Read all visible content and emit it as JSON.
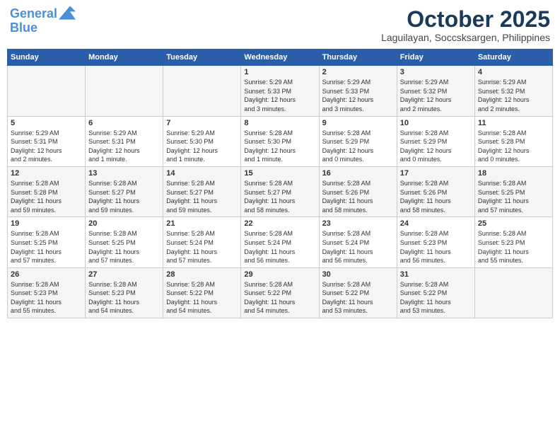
{
  "header": {
    "logo_line1": "General",
    "logo_line2": "Blue",
    "month": "October 2025",
    "location": "Laguilayan, Soccsksargen, Philippines"
  },
  "weekdays": [
    "Sunday",
    "Monday",
    "Tuesday",
    "Wednesday",
    "Thursday",
    "Friday",
    "Saturday"
  ],
  "weeks": [
    [
      {
        "day": "",
        "info": ""
      },
      {
        "day": "",
        "info": ""
      },
      {
        "day": "",
        "info": ""
      },
      {
        "day": "1",
        "info": "Sunrise: 5:29 AM\nSunset: 5:33 PM\nDaylight: 12 hours\nand 3 minutes."
      },
      {
        "day": "2",
        "info": "Sunrise: 5:29 AM\nSunset: 5:33 PM\nDaylight: 12 hours\nand 3 minutes."
      },
      {
        "day": "3",
        "info": "Sunrise: 5:29 AM\nSunset: 5:32 PM\nDaylight: 12 hours\nand 2 minutes."
      },
      {
        "day": "4",
        "info": "Sunrise: 5:29 AM\nSunset: 5:32 PM\nDaylight: 12 hours\nand 2 minutes."
      }
    ],
    [
      {
        "day": "5",
        "info": "Sunrise: 5:29 AM\nSunset: 5:31 PM\nDaylight: 12 hours\nand 2 minutes."
      },
      {
        "day": "6",
        "info": "Sunrise: 5:29 AM\nSunset: 5:31 PM\nDaylight: 12 hours\nand 1 minute."
      },
      {
        "day": "7",
        "info": "Sunrise: 5:29 AM\nSunset: 5:30 PM\nDaylight: 12 hours\nand 1 minute."
      },
      {
        "day": "8",
        "info": "Sunrise: 5:28 AM\nSunset: 5:30 PM\nDaylight: 12 hours\nand 1 minute."
      },
      {
        "day": "9",
        "info": "Sunrise: 5:28 AM\nSunset: 5:29 PM\nDaylight: 12 hours\nand 0 minutes."
      },
      {
        "day": "10",
        "info": "Sunrise: 5:28 AM\nSunset: 5:29 PM\nDaylight: 12 hours\nand 0 minutes."
      },
      {
        "day": "11",
        "info": "Sunrise: 5:28 AM\nSunset: 5:28 PM\nDaylight: 12 hours\nand 0 minutes."
      }
    ],
    [
      {
        "day": "12",
        "info": "Sunrise: 5:28 AM\nSunset: 5:28 PM\nDaylight: 11 hours\nand 59 minutes."
      },
      {
        "day": "13",
        "info": "Sunrise: 5:28 AM\nSunset: 5:27 PM\nDaylight: 11 hours\nand 59 minutes."
      },
      {
        "day": "14",
        "info": "Sunrise: 5:28 AM\nSunset: 5:27 PM\nDaylight: 11 hours\nand 59 minutes."
      },
      {
        "day": "15",
        "info": "Sunrise: 5:28 AM\nSunset: 5:27 PM\nDaylight: 11 hours\nand 58 minutes."
      },
      {
        "day": "16",
        "info": "Sunrise: 5:28 AM\nSunset: 5:26 PM\nDaylight: 11 hours\nand 58 minutes."
      },
      {
        "day": "17",
        "info": "Sunrise: 5:28 AM\nSunset: 5:26 PM\nDaylight: 11 hours\nand 58 minutes."
      },
      {
        "day": "18",
        "info": "Sunrise: 5:28 AM\nSunset: 5:25 PM\nDaylight: 11 hours\nand 57 minutes."
      }
    ],
    [
      {
        "day": "19",
        "info": "Sunrise: 5:28 AM\nSunset: 5:25 PM\nDaylight: 11 hours\nand 57 minutes."
      },
      {
        "day": "20",
        "info": "Sunrise: 5:28 AM\nSunset: 5:25 PM\nDaylight: 11 hours\nand 57 minutes."
      },
      {
        "day": "21",
        "info": "Sunrise: 5:28 AM\nSunset: 5:24 PM\nDaylight: 11 hours\nand 57 minutes."
      },
      {
        "day": "22",
        "info": "Sunrise: 5:28 AM\nSunset: 5:24 PM\nDaylight: 11 hours\nand 56 minutes."
      },
      {
        "day": "23",
        "info": "Sunrise: 5:28 AM\nSunset: 5:24 PM\nDaylight: 11 hours\nand 56 minutes."
      },
      {
        "day": "24",
        "info": "Sunrise: 5:28 AM\nSunset: 5:23 PM\nDaylight: 11 hours\nand 56 minutes."
      },
      {
        "day": "25",
        "info": "Sunrise: 5:28 AM\nSunset: 5:23 PM\nDaylight: 11 hours\nand 55 minutes."
      }
    ],
    [
      {
        "day": "26",
        "info": "Sunrise: 5:28 AM\nSunset: 5:23 PM\nDaylight: 11 hours\nand 55 minutes."
      },
      {
        "day": "27",
        "info": "Sunrise: 5:28 AM\nSunset: 5:23 PM\nDaylight: 11 hours\nand 54 minutes."
      },
      {
        "day": "28",
        "info": "Sunrise: 5:28 AM\nSunset: 5:22 PM\nDaylight: 11 hours\nand 54 minutes."
      },
      {
        "day": "29",
        "info": "Sunrise: 5:28 AM\nSunset: 5:22 PM\nDaylight: 11 hours\nand 54 minutes."
      },
      {
        "day": "30",
        "info": "Sunrise: 5:28 AM\nSunset: 5:22 PM\nDaylight: 11 hours\nand 53 minutes."
      },
      {
        "day": "31",
        "info": "Sunrise: 5:28 AM\nSunset: 5:22 PM\nDaylight: 11 hours\nand 53 minutes."
      },
      {
        "day": "",
        "info": ""
      }
    ]
  ]
}
